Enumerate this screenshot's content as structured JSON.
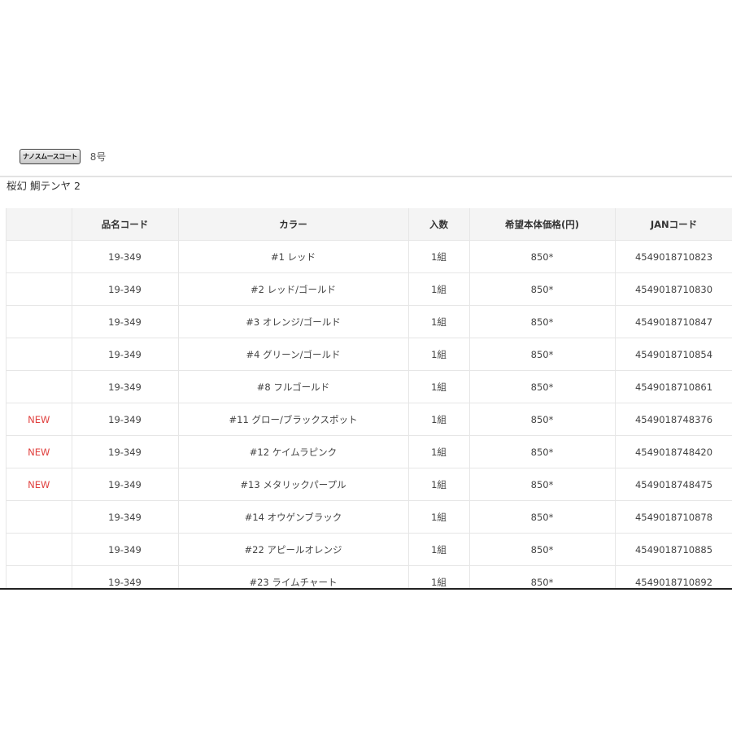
{
  "badge": {
    "label": "ナノスムースコート"
  },
  "size": "8号",
  "product_title": "桜幻 鯛テンヤ 2",
  "table": {
    "columns": [
      "",
      "品名コード",
      "カラー",
      "入数",
      "希望本体価格(円)",
      "JANコード"
    ],
    "rows": [
      {
        "tag": "",
        "code": "19-349",
        "color": "#1 レッド",
        "qty": "1組",
        "price": "850*",
        "jan": "4549018710823"
      },
      {
        "tag": "",
        "code": "19-349",
        "color": "#2 レッド/ゴールド",
        "qty": "1組",
        "price": "850*",
        "jan": "4549018710830"
      },
      {
        "tag": "",
        "code": "19-349",
        "color": "#3 オレンジ/ゴールド",
        "qty": "1組",
        "price": "850*",
        "jan": "4549018710847"
      },
      {
        "tag": "",
        "code": "19-349",
        "color": "#4 グリーン/ゴールド",
        "qty": "1組",
        "price": "850*",
        "jan": "4549018710854"
      },
      {
        "tag": "",
        "code": "19-349",
        "color": "#8 フルゴールド",
        "qty": "1組",
        "price": "850*",
        "jan": "4549018710861"
      },
      {
        "tag": "NEW",
        "code": "19-349",
        "color": "#11 グロー/ブラックスポット",
        "qty": "1組",
        "price": "850*",
        "jan": "4549018748376"
      },
      {
        "tag": "NEW",
        "code": "19-349",
        "color": "#12 ケイムラピンク",
        "qty": "1組",
        "price": "850*",
        "jan": "4549018748420"
      },
      {
        "tag": "NEW",
        "code": "19-349",
        "color": "#13 メタリックパープル",
        "qty": "1組",
        "price": "850*",
        "jan": "4549018748475"
      },
      {
        "tag": "",
        "code": "19-349",
        "color": "#14 オウゲンブラック",
        "qty": "1組",
        "price": "850*",
        "jan": "4549018710878"
      },
      {
        "tag": "",
        "code": "19-349",
        "color": "#22 アピールオレンジ",
        "qty": "1組",
        "price": "850*",
        "jan": "4549018710885"
      },
      {
        "tag": "",
        "code": "19-349",
        "color": "#23 ライムチャート",
        "qty": "1組",
        "price": "850*",
        "jan": "4549018710892"
      }
    ]
  },
  "colors": {
    "new_tag": "#e0403e",
    "header_bg": "#f4f4f4",
    "border": "#e6e6e6"
  }
}
